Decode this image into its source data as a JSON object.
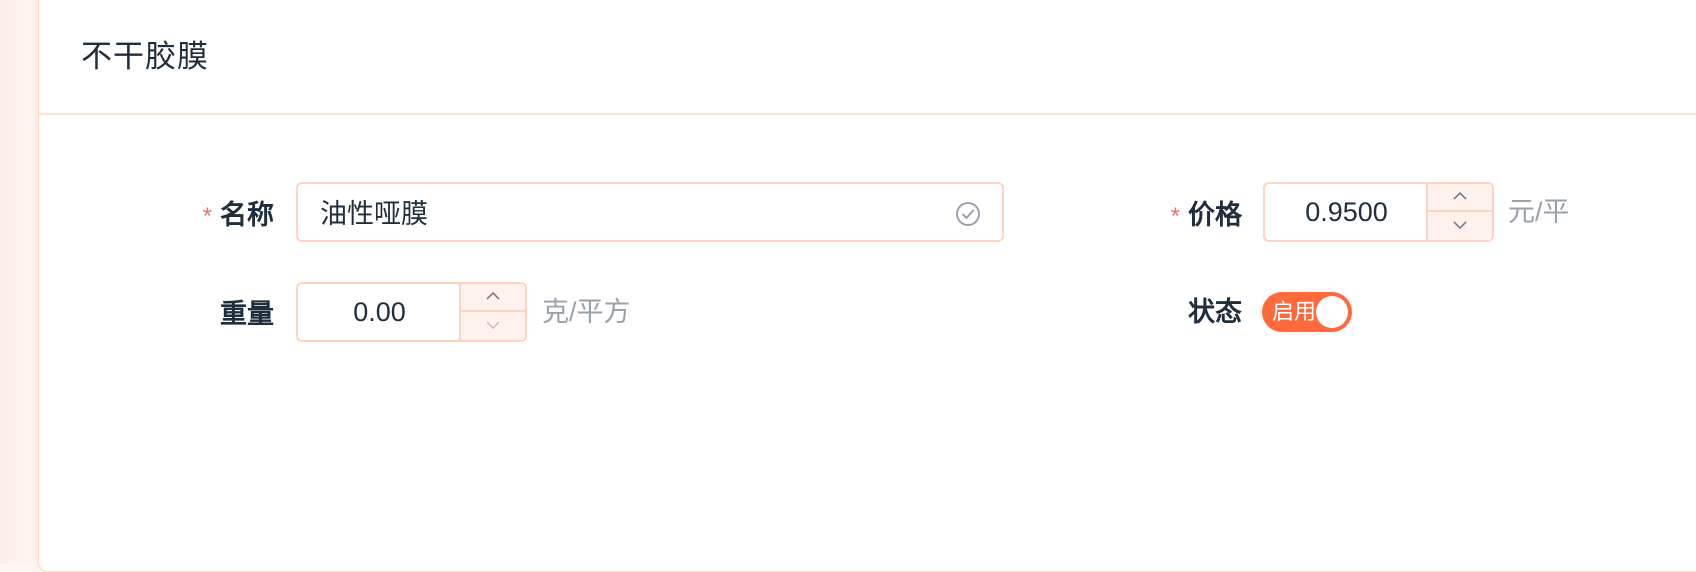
{
  "dialog": {
    "title": "不干胶膜"
  },
  "form": {
    "name": {
      "label": "名称",
      "required_mark": "*",
      "value": "油性哑膜",
      "valid": true
    },
    "price": {
      "label": "价格",
      "required_mark": "*",
      "value": "0.9500",
      "unit": "元/平"
    },
    "weight": {
      "label": "重量",
      "value": "0.00",
      "unit": "克/平方"
    },
    "status": {
      "label": "状态",
      "switch_text": "启用",
      "enabled": true
    }
  },
  "colors": {
    "accent": "#ff6a3d",
    "border": "#ffd3c2",
    "required": "#f56c6c",
    "muted_text": "#9aa1ab"
  }
}
